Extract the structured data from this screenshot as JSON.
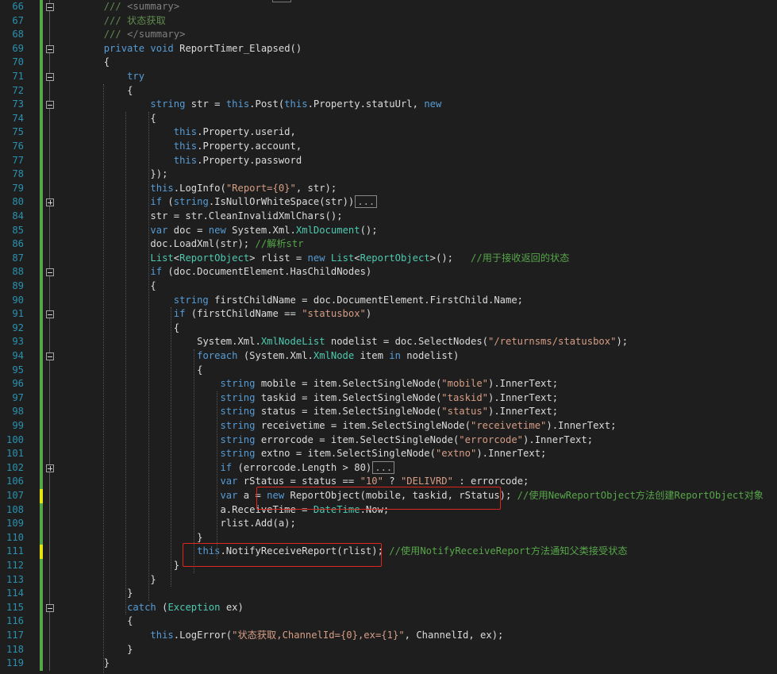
{
  "editor": {
    "lines": [
      {
        "n": "66",
        "fold": "minus",
        "chg": "add",
        "html": "<span class=\"xd\">/// </span><span class=\"xt\">&lt;summary&gt;</span>",
        "indent": "        "
      },
      {
        "n": "67",
        "fold": "",
        "chg": "add",
        "html": "<span class=\"xd\">/// 状态获取</span>",
        "indent": "        "
      },
      {
        "n": "68",
        "fold": "",
        "chg": "add",
        "html": "<span class=\"xd\">/// </span><span class=\"xt\">&lt;/summary&gt;</span>",
        "indent": "        "
      },
      {
        "n": "69",
        "fold": "minus",
        "chg": "add",
        "html": "<span class=\"kw\">private</span> <span class=\"kw\">void</span> ReportTimer_Elapsed()",
        "indent": "        "
      },
      {
        "n": "70",
        "fold": "",
        "chg": "add",
        "html": "{",
        "indent": "        "
      },
      {
        "n": "71",
        "fold": "minus",
        "chg": "add",
        "html": "<span class=\"kw\">try</span>",
        "indent": "            "
      },
      {
        "n": "72",
        "fold": "",
        "chg": "add",
        "html": "{",
        "indent": "            "
      },
      {
        "n": "73",
        "fold": "minus",
        "chg": "add",
        "html": "<span class=\"kw\">string</span> str = <span class=\"kw\">this</span>.Post(<span class=\"kw\">this</span>.Property.statuUrl, <span class=\"kw\">new</span>",
        "indent": "                "
      },
      {
        "n": "74",
        "fold": "",
        "chg": "add",
        "html": "{",
        "indent": "                "
      },
      {
        "n": "75",
        "fold": "",
        "chg": "add",
        "html": "<span class=\"kw\">this</span>.Property.userid,",
        "indent": "                    "
      },
      {
        "n": "76",
        "fold": "",
        "chg": "add",
        "html": "<span class=\"kw\">this</span>.Property.account,",
        "indent": "                    "
      },
      {
        "n": "77",
        "fold": "",
        "chg": "add",
        "html": "<span class=\"kw\">this</span>.Property.password",
        "indent": "                    "
      },
      {
        "n": "78",
        "fold": "",
        "chg": "add",
        "html": "});",
        "indent": "                "
      },
      {
        "n": "79",
        "fold": "",
        "chg": "add",
        "html": "<span class=\"kw\">this</span>.LogInfo(<span class=\"st\">\"Report={0}\"</span>, str);",
        "indent": "                "
      },
      {
        "n": "80",
        "fold": "plus",
        "chg": "add",
        "html": "<span class=\"kw\">if</span> (<span class=\"kw\">string</span>.IsNullOrWhiteSpace(str))<span class=\"collapsed\">...</span>",
        "indent": "                "
      },
      {
        "n": "84",
        "fold": "",
        "chg": "add",
        "html": "str = str.CleanInvalidXmlChars();",
        "indent": "                "
      },
      {
        "n": "85",
        "fold": "",
        "chg": "add",
        "html": "<span class=\"kw\">var</span> doc = <span class=\"kw\">new</span> System.Xml.<span class=\"ty\">XmlDocument</span>();",
        "indent": "                "
      },
      {
        "n": "86",
        "fold": "",
        "chg": "add",
        "html": "doc.LoadXml(str); <span class=\"cm\">//解析str</span>",
        "indent": "                "
      },
      {
        "n": "87",
        "fold": "",
        "chg": "add",
        "html": "<span class=\"ty\">List</span>&lt;<span class=\"ty\">ReportObject</span>&gt; rlist = <span class=\"kw\">new</span> <span class=\"ty\">List</span>&lt;<span class=\"ty\">ReportObject</span>&gt;();   <span class=\"cm\">//用于接收返回的状态</span>",
        "indent": "                "
      },
      {
        "n": "88",
        "fold": "minus",
        "chg": "add",
        "html": "<span class=\"kw\">if</span> (doc.DocumentElement.HasChildNodes)",
        "indent": "                "
      },
      {
        "n": "89",
        "fold": "",
        "chg": "add",
        "html": "{",
        "indent": "                "
      },
      {
        "n": "90",
        "fold": "",
        "chg": "add",
        "html": "<span class=\"kw\">string</span> firstChildName = doc.DocumentElement.FirstChild.Name;",
        "indent": "                    "
      },
      {
        "n": "91",
        "fold": "minus",
        "chg": "add",
        "html": "<span class=\"kw\">if</span> (firstChildName == <span class=\"st\">\"statusbox\"</span>)",
        "indent": "                    "
      },
      {
        "n": "92",
        "fold": "",
        "chg": "add",
        "html": "{",
        "indent": "                    "
      },
      {
        "n": "93",
        "fold": "",
        "chg": "add",
        "html": "System.Xml.<span class=\"ty\">XmlNodeList</span> nodelist = doc.SelectNodes(<span class=\"st\">\"/returnsms/statusbox\"</span>);",
        "indent": "                        "
      },
      {
        "n": "94",
        "fold": "minus",
        "chg": "add",
        "html": "<span class=\"kw\">foreach</span> (System.Xml.<span class=\"ty\">XmlNode</span> item <span class=\"kw\">in</span> nodelist)",
        "indent": "                        "
      },
      {
        "n": "95",
        "fold": "",
        "chg": "add",
        "html": "{",
        "indent": "                        "
      },
      {
        "n": "96",
        "fold": "",
        "chg": "add",
        "html": "<span class=\"kw\">string</span> mobile = item.SelectSingleNode(<span class=\"st\">\"mobile\"</span>).InnerText;",
        "indent": "                            "
      },
      {
        "n": "97",
        "fold": "",
        "chg": "add",
        "html": "<span class=\"kw\">string</span> taskid = item.SelectSingleNode(<span class=\"st\">\"taskid\"</span>).InnerText;",
        "indent": "                            "
      },
      {
        "n": "98",
        "fold": "",
        "chg": "add",
        "html": "<span class=\"kw\">string</span> status = item.SelectSingleNode(<span class=\"st\">\"status\"</span>).InnerText;",
        "indent": "                            "
      },
      {
        "n": "99",
        "fold": "",
        "chg": "add",
        "html": "<span class=\"kw\">string</span> receivetime = item.SelectSingleNode(<span class=\"st\">\"receivetime\"</span>).InnerText;",
        "indent": "                            "
      },
      {
        "n": "100",
        "fold": "",
        "chg": "add",
        "html": "<span class=\"kw\">string</span> errorcode = item.SelectSingleNode(<span class=\"st\">\"errorcode\"</span>).InnerText;",
        "indent": "                            "
      },
      {
        "n": "101",
        "fold": "",
        "chg": "add",
        "html": "<span class=\"kw\">string</span> extno = item.SelectSingleNode(<span class=\"st\">\"extno\"</span>).InnerText;",
        "indent": "                            "
      },
      {
        "n": "102",
        "fold": "plus",
        "chg": "add",
        "html": "<span class=\"kw\">if</span> (errorcode.Length &gt; 80)<span class=\"collapsed\">...</span>",
        "indent": "                            "
      },
      {
        "n": "106",
        "fold": "",
        "chg": "add",
        "html": "<span class=\"kw\">var</span> rStatus = status == <span class=\"st\">\"10\"</span> ? <span class=\"st\">\"DELIVRD\"</span> : errorcode;",
        "indent": "                            "
      },
      {
        "n": "107",
        "fold": "",
        "chg": "mod",
        "html": "<span class=\"kw\">var</span> a = <span class=\"kw\">new</span> ReportObject(mobile, taskid, rStatus); <span class=\"cm\">//使用NewReportObject方法创建ReportObject对象</span>",
        "indent": "                            "
      },
      {
        "n": "108",
        "fold": "",
        "chg": "add",
        "html": "a.ReceiveTime = <span class=\"ty\">DateTime</span>.Now;",
        "indent": "                            "
      },
      {
        "n": "109",
        "fold": "",
        "chg": "add",
        "html": "rlist.Add(a);",
        "indent": "                            "
      },
      {
        "n": "110",
        "fold": "",
        "chg": "add",
        "html": "}",
        "indent": "                        "
      },
      {
        "n": "111",
        "fold": "",
        "chg": "mod",
        "html": "<span class=\"kw\">this</span>.NotifyReceiveReport(rlist); <span class=\"cm\">//使用NotifyReceiveReport方法通知父类接受状态</span>",
        "indent": "                        "
      },
      {
        "n": "112",
        "fold": "",
        "chg": "add",
        "html": "}",
        "indent": "                    "
      },
      {
        "n": "113",
        "fold": "",
        "chg": "add",
        "html": "}",
        "indent": "                "
      },
      {
        "n": "114",
        "fold": "",
        "chg": "add",
        "html": "}",
        "indent": "            "
      },
      {
        "n": "115",
        "fold": "minus",
        "chg": "add",
        "html": "<span class=\"kw\">catch</span> (<span class=\"ty\">Exception</span> ex)",
        "indent": "            "
      },
      {
        "n": "116",
        "fold": "",
        "chg": "add",
        "html": "{",
        "indent": "            "
      },
      {
        "n": "117",
        "fold": "",
        "chg": "add",
        "html": "<span class=\"kw\">this</span>.LogError(<span class=\"st\">\"状态获取,ChannelId={0},ex={1}\"</span>, ChannelId, ex);",
        "indent": "                "
      },
      {
        "n": "118",
        "fold": "",
        "chg": "add",
        "html": "}",
        "indent": "            "
      },
      {
        "n": "119",
        "fold": "",
        "chg": "add",
        "html": "}",
        "indent": "        "
      }
    ],
    "colors": {
      "background": "#1e1e1e",
      "line_number": "#2b91af",
      "keyword": "#569cd6",
      "type": "#4ec9b0",
      "string": "#d69d85",
      "comment": "#57a64a",
      "change_added": "#57a64a",
      "change_modified": "#e5e510",
      "annotation": "#e0251d"
    }
  }
}
